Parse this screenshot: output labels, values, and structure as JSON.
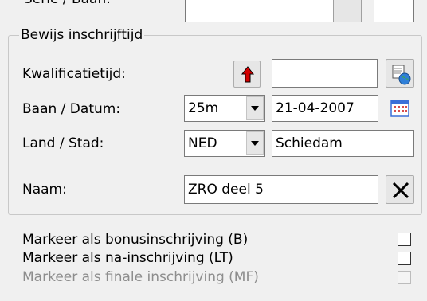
{
  "top_row": {
    "label": "Serie / Baan:"
  },
  "group": {
    "title": "Bewijs inschrijftijd"
  },
  "qualification": {
    "label": "Kwalificatietijd:",
    "value": ""
  },
  "course_date": {
    "label": "Baan / Datum:",
    "course_value": "25m",
    "date_value": "21-04-2007"
  },
  "country_city": {
    "label": "Land / Stad:",
    "country_value": "NED",
    "city_value": "Schiedam"
  },
  "name": {
    "label": "Naam:",
    "value": "ZRO deel 5"
  },
  "checkboxes": [
    {
      "label": "Markeer als bonusinschrijving (B)",
      "checked": false,
      "enabled": true
    },
    {
      "label": "Markeer als na-inschrijving (LT)",
      "checked": false,
      "enabled": true
    },
    {
      "label": "Markeer als finale inschrijving (MF)",
      "checked": false,
      "enabled": false
    }
  ],
  "icons": {
    "up_arrow": "red-up-arrow",
    "lookup": "globe-lookup",
    "calendar": "calendar",
    "clear": "x-clear"
  },
  "colors": {
    "background": "#f0f0f0",
    "arrow_red": "#d40000",
    "calendar_blue": "#3a6fd8"
  }
}
